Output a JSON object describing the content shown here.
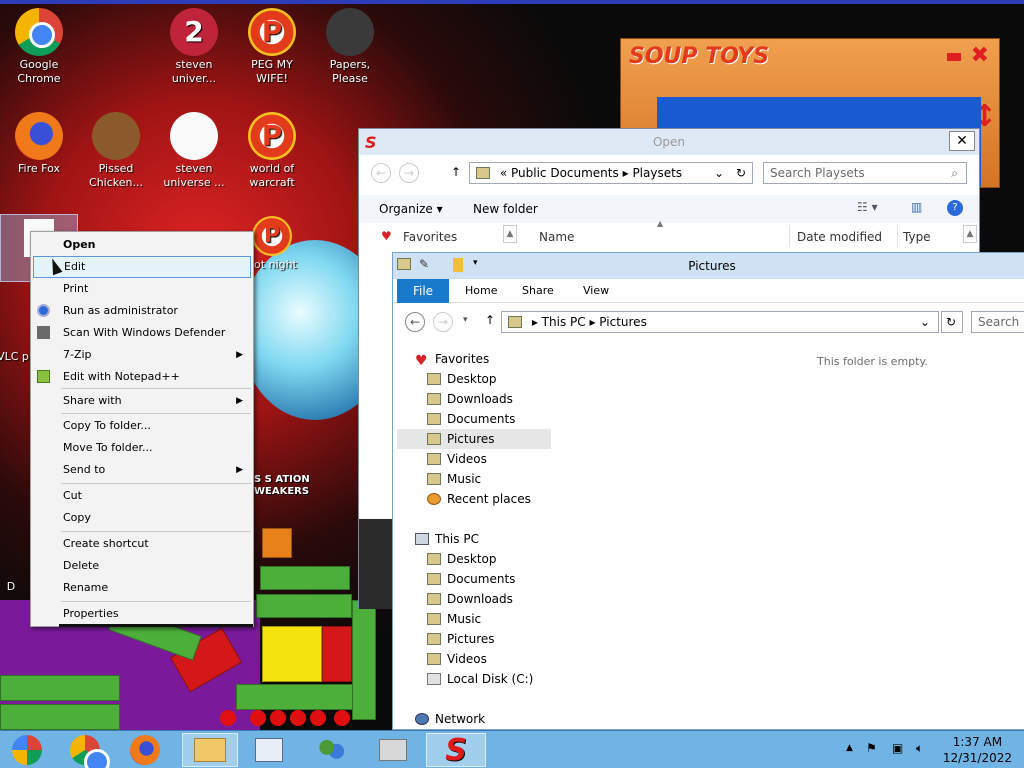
{
  "desktop_icons": [
    {
      "label": "Google Chrome",
      "icon": "chrome-icon"
    },
    {
      "label": "steven univer...",
      "icon": "steven-universe-2-icon"
    },
    {
      "label": "PEG MY WIFE!",
      "icon": "peg-icon"
    },
    {
      "label": "Papers, Please",
      "icon": "papers-please-icon"
    },
    {
      "label": "Fire Fox",
      "icon": "firefox-icon"
    },
    {
      "label": "Pissed Chicken...",
      "icon": "angry-birds-icon"
    },
    {
      "label": "steven universe ...",
      "icon": "document-icon"
    },
    {
      "label": "world of warcraft",
      "icon": "peg-icon"
    },
    {
      "label": "got night",
      "icon": "peg-icon"
    },
    {
      "label": "VLC p",
      "icon": "vlc-icon"
    },
    {
      "label": "D",
      "icon": "generic-icon"
    }
  ],
  "wallpaper_text": "S S ATION WEAKERS",
  "soup_toys": {
    "logo": "SOUP TOYS",
    "minimize": "minimize-icon",
    "close": "close-icon"
  },
  "open_dialog": {
    "title": "Open",
    "close": "✕",
    "breadcrumb": [
      "«",
      "Public Documents",
      "Playsets"
    ],
    "search_placeholder": "Search Playsets",
    "organize": "Organize",
    "new_folder": "New folder",
    "favorites": "Favorites",
    "columns": [
      "Name",
      "Date modified",
      "Type"
    ]
  },
  "pictures_window": {
    "title": "Pictures",
    "ribbon_tabs": [
      "File",
      "Home",
      "Share",
      "View"
    ],
    "breadcrumb": [
      "This PC",
      "Pictures"
    ],
    "search_placeholder": "Search P",
    "empty_message": "This folder is empty.",
    "favorites_label": "Favorites",
    "favorites": [
      "Desktop",
      "Downloads",
      "Documents",
      "Pictures",
      "Videos",
      "Music",
      "Recent places"
    ],
    "thispc_label": "This PC",
    "thispc": [
      "Desktop",
      "Documents",
      "Downloads",
      "Music",
      "Pictures",
      "Videos",
      "Local Disk (C:)"
    ],
    "network_label": "Network",
    "selected_item": "Pictures"
  },
  "context_menu": {
    "items": [
      "Open",
      "Edit",
      "Print",
      "Run as administrator",
      "Scan With Windows Defender",
      "7-Zip",
      "Edit with Notepad++",
      "Share with",
      "Copy To folder...",
      "Move To folder...",
      "Send to",
      "Cut",
      "Copy",
      "Create shortcut",
      "Delete",
      "Rename",
      "Properties"
    ],
    "highlighted": "Edit",
    "submenu_items": [
      "7-Zip",
      "Share with",
      "Send to"
    ]
  },
  "taskbar": {
    "buttons": [
      "start-icon",
      "chrome-icon",
      "firefox-icon",
      "file-explorer-icon",
      "performance-monitor-icon",
      "people-icon",
      "printer-icon",
      "soup-s-icon"
    ],
    "active": [
      "file-explorer-icon",
      "soup-s-icon"
    ],
    "time": "1:37 AM",
    "date": "12/31/2022",
    "tray_icons": [
      "show-hidden-icons-arrow",
      "flag-icon",
      "network-icon",
      "volume-icon"
    ]
  }
}
